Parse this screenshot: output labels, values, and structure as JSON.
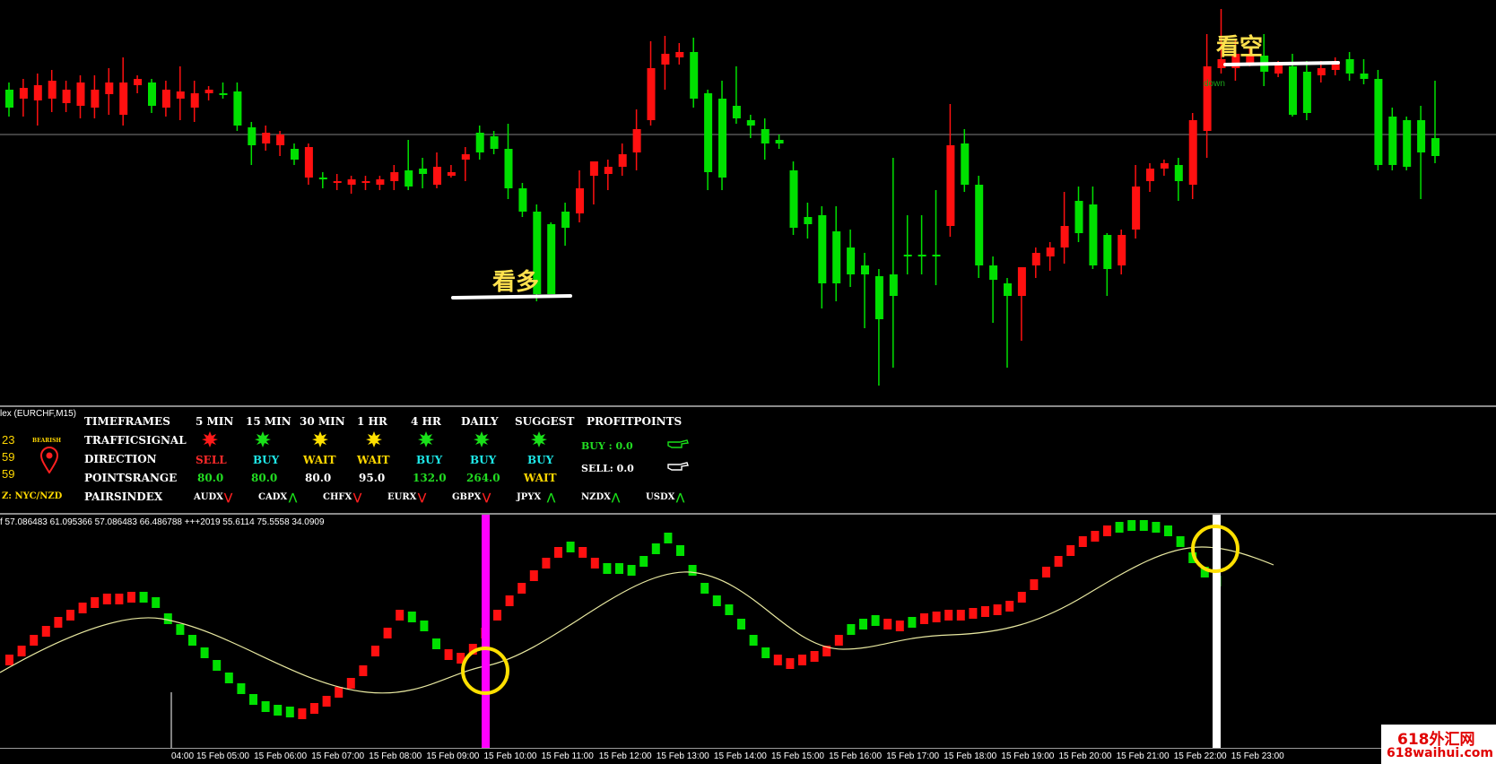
{
  "colors": {
    "bull": "#00e000",
    "bear": "#ff1010",
    "ma": "#e8e8a0",
    "magenta": "#ff00ff",
    "circle": "#ffe000"
  },
  "main": {
    "annotation_long": "看多",
    "annotation_short": "看空",
    "signal_down": "down"
  },
  "dashboard": {
    "indicator_name": "lex (EURCHF,M15)",
    "side_values": [
      "23",
      "59",
      "59"
    ],
    "badge": "BEARISH",
    "pair_zone": "Z: NYC/NZD",
    "rows": {
      "timeframes": "TIMEFRAMES",
      "trafficsignal": "TRAFFICSIGNAL",
      "direction": "DIRECTION",
      "pointsrange": "POINTSRANGE",
      "pairsindex": "PAIRSINDEX"
    },
    "columns": [
      {
        "label": "5 MIN",
        "signal": "red",
        "direction": "SELL",
        "points": "80.0"
      },
      {
        "label": "15 MIN",
        "signal": "green",
        "direction": "BUY",
        "points": "80.0"
      },
      {
        "label": "30 MIN",
        "signal": "yellow",
        "direction": "WAIT",
        "points": "80.0"
      },
      {
        "label": "1 HR",
        "signal": "yellow",
        "direction": "WAIT",
        "points": "95.0"
      },
      {
        "label": "4 HR",
        "signal": "green",
        "direction": "BUY",
        "points": "132.0"
      },
      {
        "label": "DAILY",
        "signal": "green",
        "direction": "BUY",
        "points": "264.0"
      },
      {
        "label": "SUGGEST",
        "signal": "green",
        "direction": "BUY",
        "points": "WAIT"
      }
    ],
    "profit": {
      "title": "PROFITPOINTS",
      "buy": "BUY :  0.0",
      "sell": "SELL:  0.0"
    },
    "pairs": [
      {
        "name": "AUDX",
        "trend": "down"
      },
      {
        "name": "CADX",
        "trend": "up"
      },
      {
        "name": "CHFX",
        "trend": "down"
      },
      {
        "name": "EURX",
        "trend": "down"
      },
      {
        "name": "GBPX",
        "trend": "down"
      },
      {
        "name": "JPYX",
        "trend": "up"
      },
      {
        "name": "NZDX",
        "trend": "up"
      },
      {
        "name": "USDX",
        "trend": "up"
      }
    ]
  },
  "oscillator": {
    "header": "f 57.086483 61.095366 57.086483 66.486788   +++2019 55.6114 75.5558 34.0909"
  },
  "time_axis": [
    "04:00",
    "15 Feb 05:00",
    "15 Feb 06:00",
    "15 Feb 07:00",
    "15 Feb 08:00",
    "15 Feb 09:00",
    "15 Feb 10:00",
    "15 Feb 11:00",
    "15 Feb 12:00",
    "15 Feb 13:00",
    "15 Feb 14:00",
    "15 Feb 15:00",
    "15 Feb 16:00",
    "15 Feb 17:00",
    "15 Feb 18:00",
    "15 Feb 19:00",
    "15 Feb 20:00",
    "15 Feb 21:00",
    "15 Feb 22:00",
    "15 Feb 23:00"
  ],
  "watermark": {
    "line1": "618外汇网",
    "line2": "618waihui.com"
  }
}
